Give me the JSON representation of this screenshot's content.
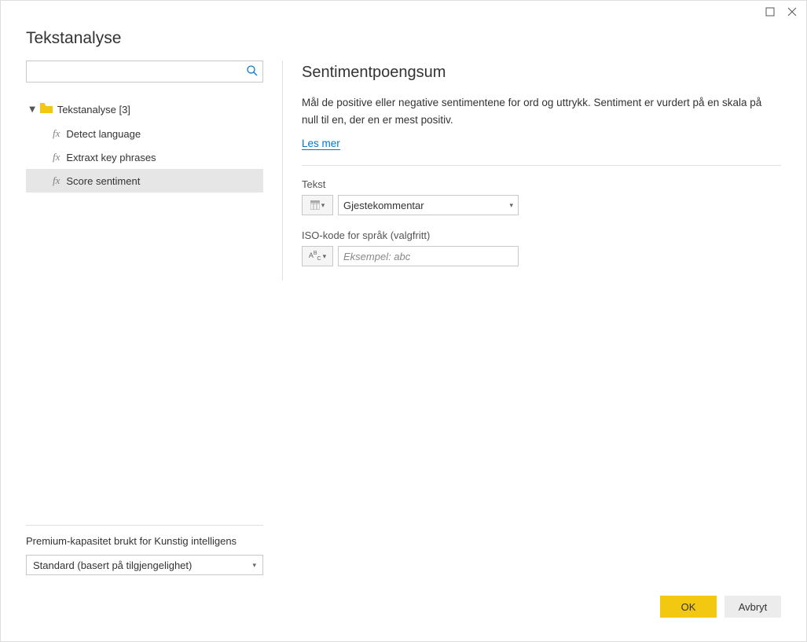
{
  "window": {
    "title": "Tekstanalyse"
  },
  "search": {
    "placeholder": ""
  },
  "tree": {
    "root_label": "Tekstanalyse [3]",
    "items": [
      {
        "label": "Detect language",
        "selected": false
      },
      {
        "label": "Extraxt key phrases",
        "selected": false
      },
      {
        "label": "Score sentiment",
        "selected": true
      }
    ]
  },
  "detail": {
    "title": "Sentimentpoengsum",
    "description": "Mål de positive eller negative sentimentene for ord og uttrykk. Sentiment er vurdert på en skala på null til en, der en er mest positiv.",
    "learn_more": "Les mer",
    "fields": {
      "text": {
        "label": "Tekst",
        "value": "Gjestekommentar"
      },
      "iso": {
        "label": "ISO-kode for språk (valgfritt)",
        "placeholder": "Eksempel: abc"
      }
    }
  },
  "capacity": {
    "label": "Premium-kapasitet brukt for Kunstig intelligens",
    "value": "Standard (basert på tilgjengelighet)"
  },
  "buttons": {
    "ok": "OK",
    "cancel": "Avbryt"
  }
}
